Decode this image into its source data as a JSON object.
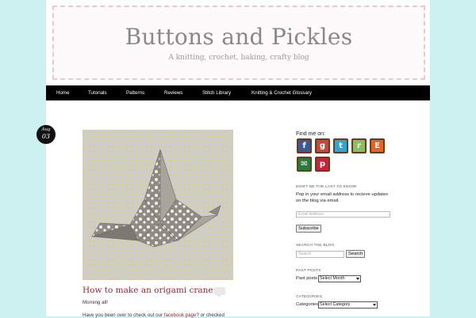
{
  "site": {
    "title": "Buttons and Pickles",
    "tagline": "A knitting, crochet, baking, crafty blog"
  },
  "nav": {
    "items": [
      {
        "label": "Home"
      },
      {
        "label": "Tutorials"
      },
      {
        "label": "Patterns"
      },
      {
        "label": "Reviews"
      },
      {
        "label": "Stitch Library"
      },
      {
        "label": "Knitting & Crochet Glossary"
      }
    ]
  },
  "post": {
    "date_month": "Aug",
    "date_day": "03",
    "title": "How to make an origami crane",
    "intro": "Morning all!",
    "body_prefix": "Have you been over to check out our ",
    "body_link": "facebook page",
    "body_suffix": "?  or checked"
  },
  "sidebar": {
    "find_me_label": "Find me on:",
    "social_icons": [
      {
        "name": "facebook-icon",
        "glyph": "f",
        "color": "#3b5998"
      },
      {
        "name": "google-plus-icon",
        "glyph": "g",
        "color": "#c8473b"
      },
      {
        "name": "twitter-icon",
        "glyph": "t",
        "color": "#2ea4d8"
      },
      {
        "name": "ravelry-icon",
        "glyph": "r",
        "color": "#86c25b"
      },
      {
        "name": "etsy-icon",
        "glyph": "E",
        "color": "#e0652a"
      },
      {
        "name": "email-icon",
        "glyph": "✉",
        "color": "#2a7a3c"
      },
      {
        "name": "pinterest-icon",
        "glyph": "p",
        "color": "#c8233a"
      }
    ],
    "subscribe": {
      "title": "DON'T BE THE LAST TO KNOW!",
      "text_line1": "Pop in your email address to recieve updates",
      "text_line2": "on the blog via email.",
      "email_placeholder": "Email Address",
      "button": "Subscribe"
    },
    "search": {
      "title": "SEARCH THE BLOG",
      "placeholder": "Search",
      "button": "Search"
    },
    "past_posts": {
      "title": "PAST POSTS",
      "label": "Past posts",
      "selected": "Select Month"
    },
    "categories": {
      "title": "CATEGORIES",
      "label": "Categories",
      "selected": "Select Category"
    }
  }
}
